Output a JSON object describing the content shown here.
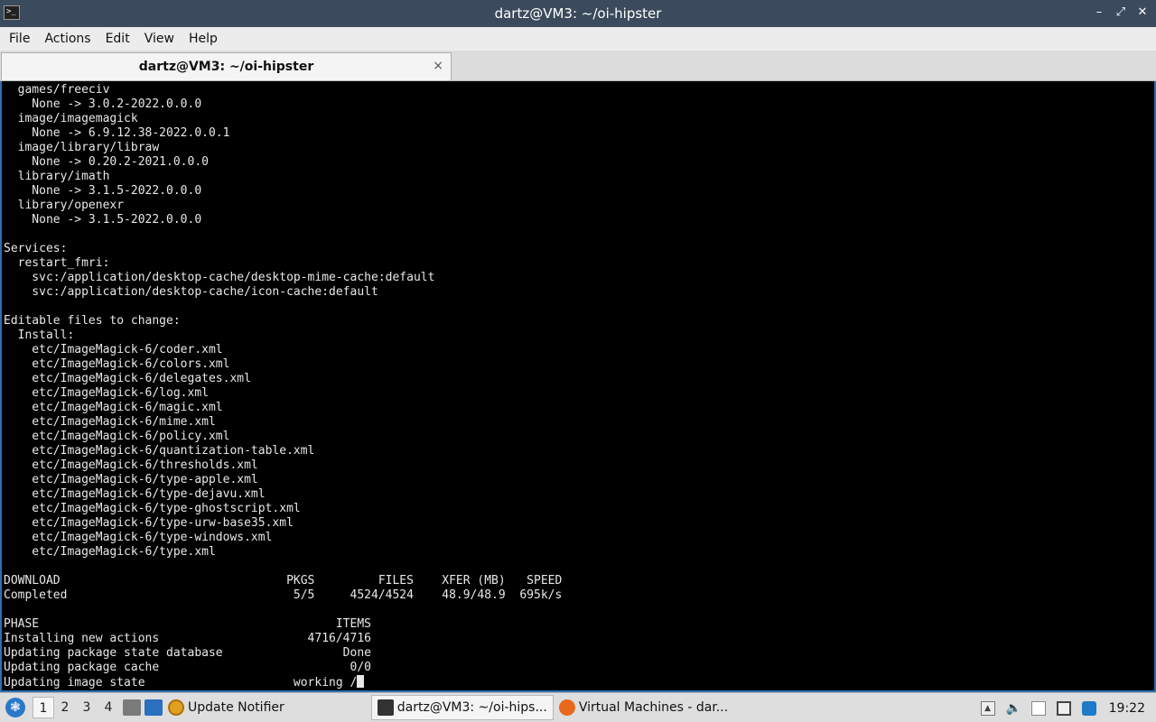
{
  "window": {
    "title": "dartz@VM3: ~/oi-hipster",
    "app_icon": "terminal-icon",
    "controls": [
      "minimize",
      "maximize",
      "close"
    ]
  },
  "menu": [
    "File",
    "Actions",
    "Edit",
    "View",
    "Help"
  ],
  "tab": {
    "label": "dartz@VM3: ~/oi-hipster",
    "close_glyph": "×"
  },
  "terminal": {
    "lines": [
      "  games/freeciv",
      "    None -> 3.0.2-2022.0.0.0",
      "  image/imagemagick",
      "    None -> 6.9.12.38-2022.0.0.1",
      "  image/library/libraw",
      "    None -> 0.20.2-2021.0.0.0",
      "  library/imath",
      "    None -> 3.1.5-2022.0.0.0",
      "  library/openexr",
      "    None -> 3.1.5-2022.0.0.0",
      "",
      "Services:",
      "  restart_fmri:",
      "    svc:/application/desktop-cache/desktop-mime-cache:default",
      "    svc:/application/desktop-cache/icon-cache:default",
      "",
      "Editable files to change:",
      "  Install:",
      "    etc/ImageMagick-6/coder.xml",
      "    etc/ImageMagick-6/colors.xml",
      "    etc/ImageMagick-6/delegates.xml",
      "    etc/ImageMagick-6/log.xml",
      "    etc/ImageMagick-6/magic.xml",
      "    etc/ImageMagick-6/mime.xml",
      "    etc/ImageMagick-6/policy.xml",
      "    etc/ImageMagick-6/quantization-table.xml",
      "    etc/ImageMagick-6/thresholds.xml",
      "    etc/ImageMagick-6/type-apple.xml",
      "    etc/ImageMagick-6/type-dejavu.xml",
      "    etc/ImageMagick-6/type-ghostscript.xml",
      "    etc/ImageMagick-6/type-urw-base35.xml",
      "    etc/ImageMagick-6/type-windows.xml",
      "    etc/ImageMagick-6/type.xml",
      "",
      "DOWNLOAD                                PKGS         FILES    XFER (MB)   SPEED",
      "Completed                                5/5     4524/4524    48.9/48.9  695k/s",
      "",
      "PHASE                                          ITEMS",
      "Installing new actions                     4716/4716",
      "Updating package state database                 Done",
      "Updating package cache                           0/0"
    ],
    "last_line": "Updating image state                     working /"
  },
  "taskbar": {
    "start_icon": "start-menu-icon",
    "workspaces": [
      "1",
      "2",
      "3",
      "4"
    ],
    "active_workspace": "1",
    "tasks": [
      {
        "label": "Update Notifier",
        "icon": "update-notifier-icon"
      },
      {
        "label": "dartz@VM3: ~/oi-hips...",
        "icon": "terminal-icon",
        "active": true
      },
      {
        "label": "Virtual Machines - dar...",
        "icon": "firefox-icon"
      }
    ],
    "clock": "19:22"
  }
}
